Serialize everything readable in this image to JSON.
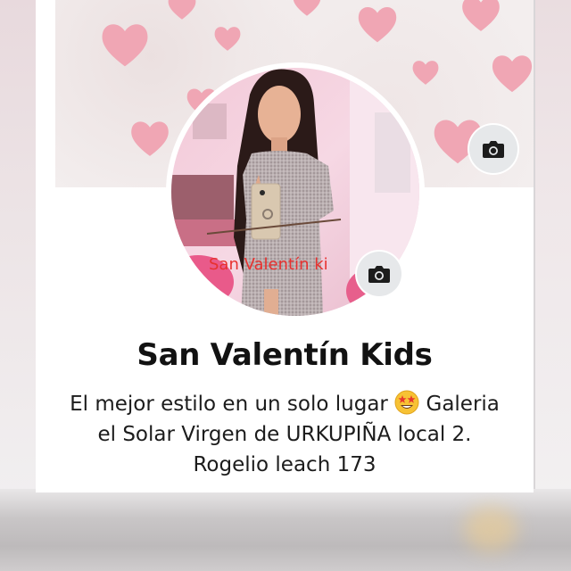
{
  "profile": {
    "name": "San Valentín Kids",
    "photo_watermark": "San Valentín ki",
    "bio": {
      "line1_text": "El mejor estilo en un solo lugar",
      "line1_emoji": "star-struck-emoji",
      "line1_after": "Galeria",
      "line2": "el Solar Virgen de URKUPIÑA local 2.",
      "line3": "Rogelio leach 173"
    }
  },
  "icons": {
    "cover_camera": "camera-icon",
    "profile_camera": "camera-icon"
  },
  "colors": {
    "heart": "#f0a6b4",
    "camera_button_bg": "#e6e8ea",
    "text": "#121212"
  }
}
